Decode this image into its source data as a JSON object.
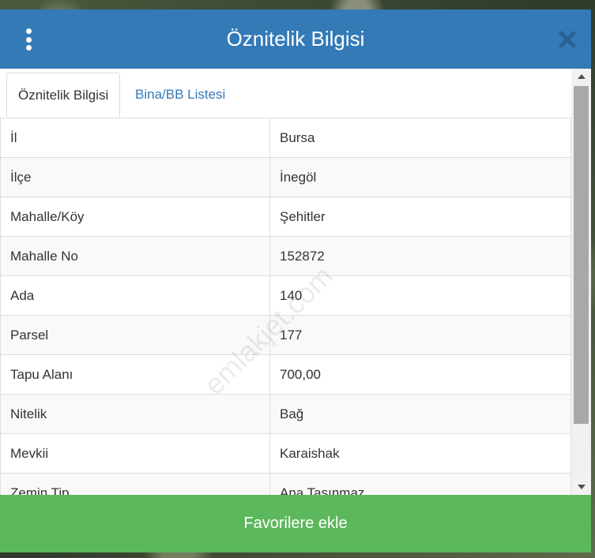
{
  "header": {
    "title": "Öznitelik Bilgisi"
  },
  "tabs": [
    {
      "label": "Öznitelik Bilgisi",
      "active": true
    },
    {
      "label": "Bina/BB Listesi",
      "active": false
    }
  ],
  "attributes": [
    {
      "key": "İl",
      "value": "Bursa"
    },
    {
      "key": "İlçe",
      "value": "İnegöl"
    },
    {
      "key": "Mahalle/Köy",
      "value": "Şehitler"
    },
    {
      "key": "Mahalle No",
      "value": "152872"
    },
    {
      "key": "Ada",
      "value": "140"
    },
    {
      "key": "Parsel",
      "value": "177"
    },
    {
      "key": "Tapu Alanı",
      "value": "700,00"
    },
    {
      "key": "Nitelik",
      "value": "Bağ"
    },
    {
      "key": "Mevkii",
      "value": "Karaishak"
    },
    {
      "key": "Zemin Tip",
      "value": "Ana Taşınmaz"
    }
  ],
  "watermark": "emlakjet.com",
  "footer": {
    "button_label": "Favorilere ekle"
  },
  "colors": {
    "header": "#337ab7",
    "footer_button": "#5cb85c"
  },
  "icons": {
    "menu": "vertical-dots-icon",
    "close": "close-icon",
    "scroll_up": "triangle-up-icon",
    "scroll_down": "triangle-down-icon"
  }
}
